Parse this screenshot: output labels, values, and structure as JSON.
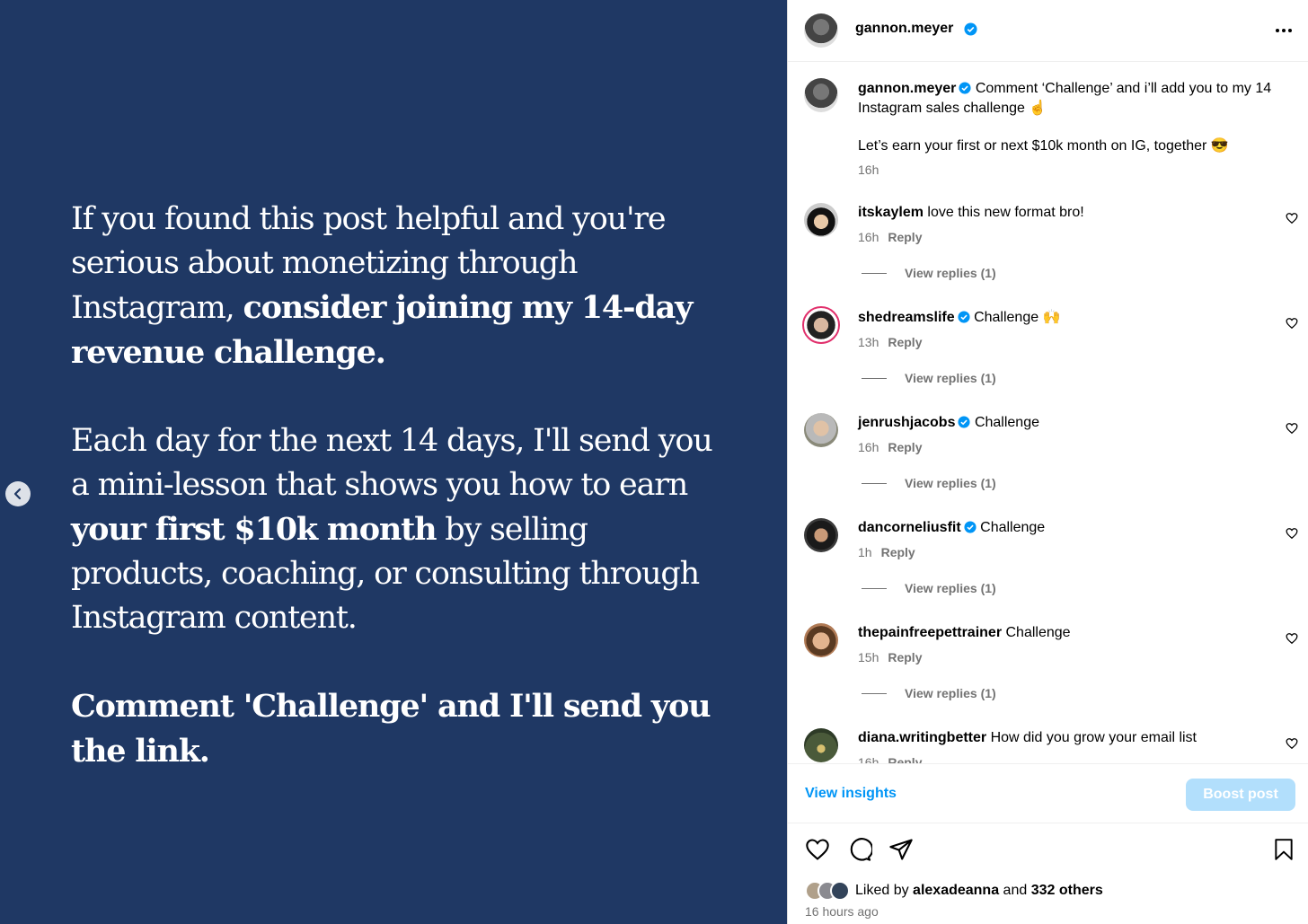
{
  "slide": {
    "p1_normal": "If you found this post helpful and you're serious about monetizing through Instagram, ",
    "p1_bold": "consider joining my 14-day revenue challenge.",
    "p2_normal_a": "Each day for the next 14 days, I'll send you a mini-lesson that shows you how to earn ",
    "p2_bold": "your first $10k month",
    "p2_normal_b": " by selling products, coaching, or consulting through Instagram content.",
    "p3_bold": "Comment 'Challenge' and I'll send you the link."
  },
  "header": {
    "username": "gannon.meyer"
  },
  "caption": {
    "username": "gannon.meyer",
    "text": "Comment ‘Challenge’ and i’ll add you to my 14 Instagram sales challenge ☝",
    "text2": "Let’s earn your first or next $10k month on IG, together 😎",
    "time": "16h"
  },
  "comments": [
    {
      "username": "itskaylem",
      "text": "love this new format bro!",
      "time": "16h",
      "reply": "Reply",
      "replies": "View replies (1)",
      "verified": false
    },
    {
      "username": "shedreamslife",
      "text": "Challenge 🙌",
      "time": "13h",
      "reply": "Reply",
      "replies": "View replies (1)",
      "verified": true
    },
    {
      "username": "jenrushjacobs",
      "text": "Challenge",
      "time": "16h",
      "reply": "Reply",
      "replies": "View replies (1)",
      "verified": true
    },
    {
      "username": "dancorneliusfit",
      "text": "Challenge",
      "time": "1h",
      "reply": "Reply",
      "replies": "View replies (1)",
      "verified": true
    },
    {
      "username": "thepainfreepettrainer",
      "text": "Challenge",
      "time": "15h",
      "reply": "Reply",
      "replies": "View replies (1)",
      "verified": false
    },
    {
      "username": "diana.writingbetter",
      "text": "How did you grow your email list",
      "time": "16h",
      "reply": "Reply",
      "verified": false
    }
  ],
  "insights": {
    "view_insights": "View insights",
    "boost_post": "Boost post"
  },
  "likes": {
    "prefix": "Liked by ",
    "user": "alexadeanna",
    "middle": " and ",
    "others": "332 others"
  },
  "timestamp": "16 hours ago",
  "icons": {
    "prev": "chevron-left-icon",
    "more": "more-horizontal-icon",
    "verified": "verified-badge-icon",
    "heart": "heart-icon",
    "comment": "comment-icon",
    "share": "share-icon",
    "save": "bookmark-icon"
  },
  "colors": {
    "slide_bg": "#1f3864",
    "link_blue": "#0095f6",
    "boost_bg": "#b2dffc",
    "verified_blue": "#0095f6"
  }
}
